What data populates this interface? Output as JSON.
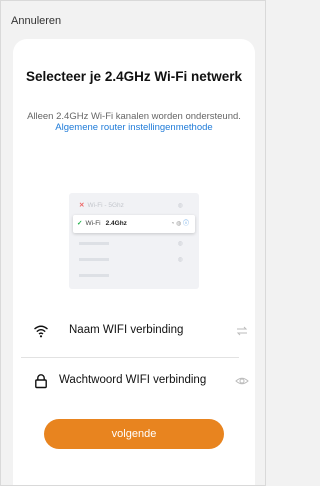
{
  "header": {
    "cancel_label": "Annuleren"
  },
  "content": {
    "title": "Selecteer je 2.4GHz Wi-Fi netwerk",
    "subtitle_prefix": "Alleen 2.4GHz Wi-Fi kanalen worden ondersteund.",
    "subtitle_link": "Algemene router instellingenmethode"
  },
  "illustration": {
    "row1_label": "Wi-Fi - 5Ghz",
    "row2_label": "Wi-Fi",
    "row2_band": "2.4Ghz"
  },
  "form": {
    "wifi_name_placeholder": "Naam WIFI verbinding",
    "wifi_password_placeholder": "Wachtwoord WIFI verbinding"
  },
  "actions": {
    "next_label": "volgende"
  },
  "colors": {
    "accent": "#e8841f",
    "link": "#1f7bd8"
  }
}
